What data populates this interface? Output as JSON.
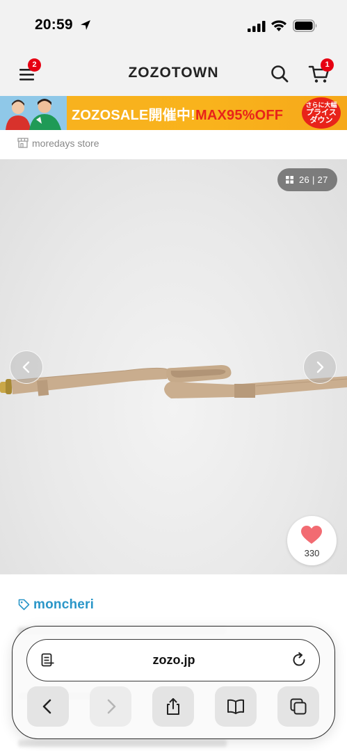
{
  "status_bar": {
    "time": "20:59"
  },
  "header": {
    "logo": "ZOZOTOWN",
    "menu_badge": "2",
    "cart_badge": "1"
  },
  "banner": {
    "text_main": "ZOZOSALE開催中!",
    "text_hot": "MAX95%OFF",
    "badge_line1": "さらに大幅",
    "badge_line2": "プライス",
    "badge_line3": "ダウン"
  },
  "store": {
    "name": "moredays store"
  },
  "gallery": {
    "counter": "26 | 27",
    "current_image": 26,
    "total_images": 27
  },
  "favorite": {
    "count": "330"
  },
  "brand": {
    "name": "moncheri"
  },
  "browser": {
    "url": "zozo.jp"
  },
  "colors": {
    "header_bg": "#f2f2f2",
    "badge_red": "#e60012",
    "banner_yellow": "#f9b31c",
    "banner_red": "#e8231a",
    "brand_blue": "#2a96c8",
    "heart_pink": "#f26b72",
    "leash_beige": "#c9ad8e"
  },
  "icons": {
    "location": "location-arrow-icon",
    "signal": "cellular-signal-icon",
    "wifi": "wifi-icon",
    "battery": "battery-icon",
    "menu": "hamburger-menu-icon",
    "search": "search-icon",
    "cart": "cart-icon",
    "store": "store-icon",
    "grid": "grid-icon",
    "prev": "chevron-left-icon",
    "next": "chevron-right-icon",
    "heart": "heart-icon",
    "tag": "tag-icon",
    "reader": "reader-icon",
    "reload": "reload-icon",
    "back": "back-icon",
    "forward": "forward-icon",
    "share": "share-icon",
    "bookmarks": "bookmarks-icon",
    "tabs": "tabs-icon"
  }
}
